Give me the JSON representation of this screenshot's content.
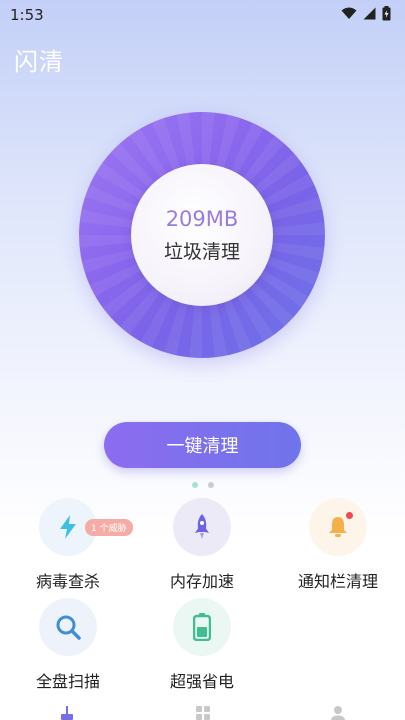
{
  "status_bar": {
    "time": "1:53"
  },
  "app": {
    "title": "闪清"
  },
  "cleaner": {
    "junk_size": "209MB",
    "junk_label": "垃圾清理",
    "button_label": "一键清理"
  },
  "features": [
    {
      "label": "病毒查杀",
      "icon": "lightning-icon",
      "badge": "1 个威胁"
    },
    {
      "label": "内存加速",
      "icon": "rocket-icon"
    },
    {
      "label": "通知栏清理",
      "icon": "bell-icon"
    },
    {
      "label": "全盘扫描",
      "icon": "magnifier-icon"
    },
    {
      "label": "超强省电",
      "icon": "battery-icon"
    }
  ],
  "colors": {
    "accent_purple": "#8c6cf0",
    "accent_blue": "#6f74ea",
    "badge": "#f6aca6"
  }
}
